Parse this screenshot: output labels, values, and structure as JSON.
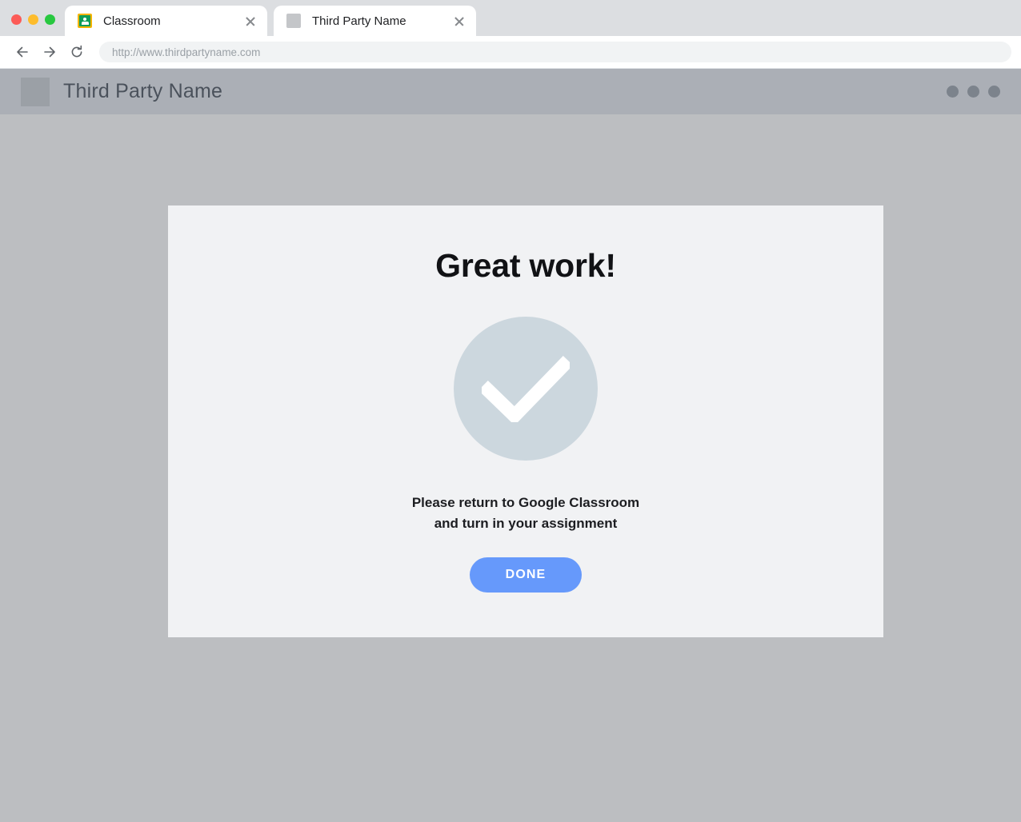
{
  "window": {
    "traffic_lights": [
      {
        "name": "close",
        "color": "#fc5b57"
      },
      {
        "name": "minimize",
        "color": "#fdbc2c"
      },
      {
        "name": "zoom",
        "color": "#28c840"
      }
    ]
  },
  "browser": {
    "tabs": [
      {
        "title": "Classroom",
        "favicon": "google-classroom-icon",
        "active": false
      },
      {
        "title": "Third Party Name",
        "favicon": "generic-placeholder-icon",
        "active": true
      }
    ],
    "close_label": "×",
    "toolbar": {
      "back_label": "Back",
      "forward_label": "Forward",
      "reload_label": "Reload",
      "url": "http://www.thirdpartyname.com"
    }
  },
  "app": {
    "header": {
      "title": "Third Party Name",
      "logo": "app-logo-placeholder",
      "menu_dots": 3
    },
    "card": {
      "heading": "Great work!",
      "status_icon": "checkmark-icon",
      "message_line1": "Please return to Google Classroom",
      "message_line2": "and turn in your assignment",
      "done_label": "DONE"
    }
  },
  "colors": {
    "page_background": "#bcbec1",
    "app_header": "#abafb6",
    "card_background": "#f1f2f4",
    "accent_button": "#6699fb",
    "check_circle": "#ccd7de",
    "tabstrip": "#dcdee1"
  }
}
